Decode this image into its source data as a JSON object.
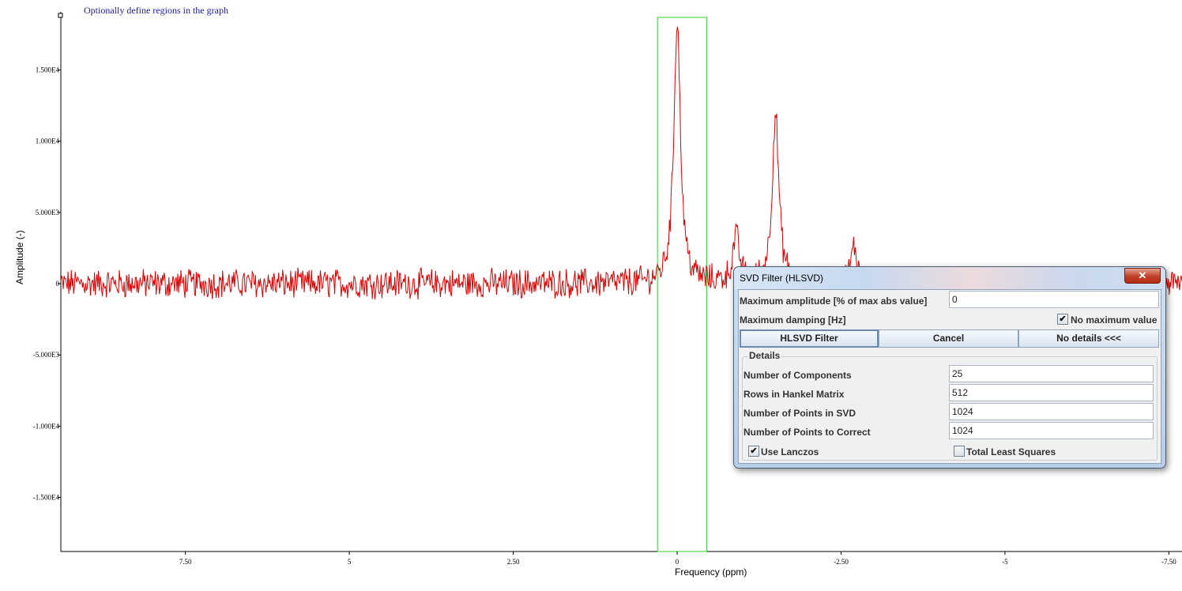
{
  "plot": {
    "hint": "Optionally define regions in the graph",
    "ylabel": "Amplitude (-)",
    "xlabel": "Frequency (ppm)",
    "y_ticks": [
      "1.500E4",
      "1.000E4",
      "5.000E3",
      "0",
      "-5.000E3",
      "-1.000E4",
      "-1.500E4"
    ],
    "x_ticks": [
      "7.50",
      "5",
      "2.50",
      "0",
      "-2.50",
      "-5",
      "-7.50"
    ],
    "colors": {
      "signal": "#e00000",
      "region": "#33cc33",
      "axis": "#000000"
    }
  },
  "chart_data": {
    "type": "line",
    "title": "",
    "xlabel": "Frequency (ppm)",
    "ylabel": "Amplitude (-)",
    "xlim": [
      9.4,
      -7.7
    ],
    "ylim": [
      -18800,
      18800
    ],
    "x_reversed": true,
    "noise_level": 900,
    "peaks": [
      {
        "x": 0.0,
        "y": 18600
      },
      {
        "x": -1.5,
        "y": 12000
      },
      {
        "x": -0.9,
        "y": 3200
      },
      {
        "x": -2.7,
        "y": 2500
      }
    ],
    "regions": [
      {
        "x_start": 0.3,
        "x_end": -0.45
      }
    ]
  },
  "dialog": {
    "title": "SVD Filter (HLSVD)",
    "close_glyph": "✕",
    "max_amplitude_label": "Maximum amplitude [% of max abs value]",
    "max_amplitude_value": "0",
    "max_damping_label": "Maximum damping [Hz]",
    "no_max_label": "No maximum value",
    "no_max_checked": true,
    "buttons": {
      "filter": "HLSVD Filter",
      "cancel": "Cancel",
      "details": "No details <<<"
    },
    "details": {
      "title": "Details",
      "components_label": "Number of Components",
      "components_value": "25",
      "rows_label": "Rows in Hankel Matrix",
      "rows_value": "512",
      "svd_points_label": "Number of Points in SVD",
      "svd_points_value": "1024",
      "correct_points_label": "Number of Points to Correct",
      "correct_points_value": "1024",
      "lanczos_label": "Use Lanczos",
      "lanczos_checked": true,
      "tls_label": "Total Least Squares",
      "tls_checked": false
    }
  }
}
